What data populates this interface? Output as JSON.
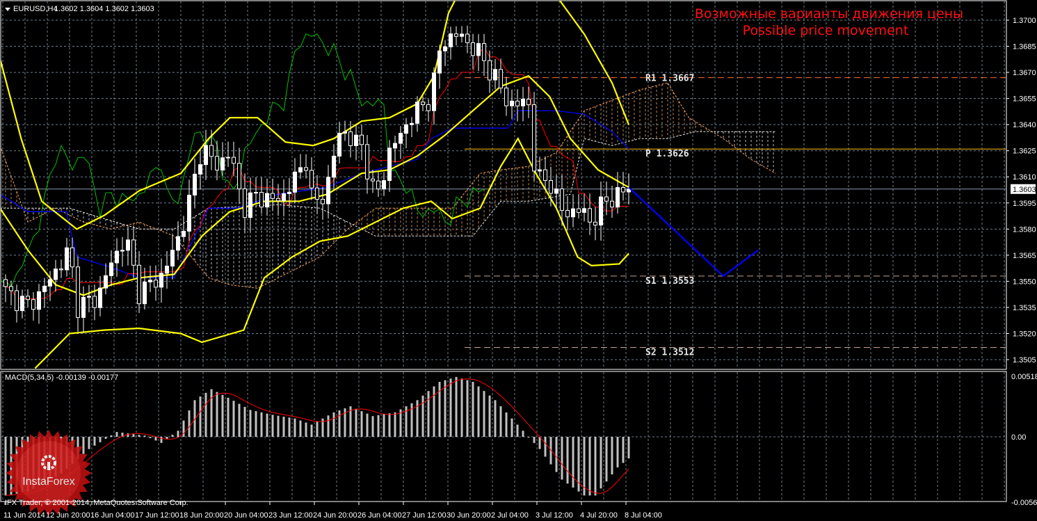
{
  "header": {
    "symbol": "EURUSD,H4",
    "ohlc": "1.3602 1.3604 1.3602 1.3603"
  },
  "annotation": {
    "line1": "Возможные варианты движения цены",
    "line2": "Possible price movement"
  },
  "macd_label": "MACD(5,34,5) -0.00139 -0.00177",
  "copyright": "IFX Trader, © 2001-2014, MetaQuotes Software Corp.",
  "watermark": "InstaForex",
  "colors": {
    "background": "#000000",
    "grid": "#6f8090",
    "band": "#ffff00",
    "tenkan": "#ff0000",
    "kijun": "#0000ff",
    "chikou": "#00c000",
    "spanA": "#f4a460",
    "spanB": "#e8e8e8",
    "projection": "#0000ff",
    "r1": "#ff6a2a",
    "pivot": "#ffc000",
    "support": "#c8a090",
    "macd_hist": "#c0c0c0",
    "macd_signal": "#ff0000"
  },
  "chart_data": {
    "type": "candlestick",
    "symbol": "EURUSD",
    "timeframe": "H4",
    "ylim": [
      1.3497,
      1.3712
    ],
    "y_ticks": [
      "1.3700",
      "1.3685",
      "1.3670",
      "1.3655",
      "1.3640",
      "1.3625",
      "1.3610",
      "1.3595",
      "1.3580",
      "1.3565",
      "1.3550",
      "1.3535",
      "1.3520",
      "1.3505"
    ],
    "current_price": "1.3603",
    "x_tick_labels": [
      "11 Jun 2014",
      "12 Jun 20:00",
      "16 Jun 04:00",
      "17 Jun 12:00",
      "18 Jun 20:00",
      "20 Jun 04:00",
      "23 Jun 12:00",
      "24 Jun 20:00",
      "26 Jun 04:00",
      "27 Jun 12:00",
      "30 Jun 20:00",
      "2 Jul 04:00",
      "3 Jul 12:00",
      "4 Jul 20:00",
      "8 Jul 04:00"
    ],
    "bar_count": 113,
    "close_keypoints": [
      [
        1,
        1.3544
      ],
      [
        5,
        1.3536
      ],
      [
        7.5,
        1.3544
      ],
      [
        12.5,
        1.3568
      ],
      [
        13.8,
        1.3536
      ],
      [
        17.5,
        1.354
      ],
      [
        18.8,
        1.3552
      ],
      [
        22.5,
        1.3576
      ],
      [
        25,
        1.3544
      ],
      [
        28.8,
        1.3552
      ],
      [
        31.3,
        1.3568
      ],
      [
        33.8,
        1.3592
      ],
      [
        36.3,
        1.3628
      ],
      [
        38.8,
        1.3616
      ],
      [
        41.3,
        1.3624
      ],
      [
        43.8,
        1.3592
      ],
      [
        46.3,
        1.36
      ],
      [
        48.8,
        1.3596
      ],
      [
        51.3,
        1.36
      ],
      [
        55,
        1.362
      ],
      [
        56.3,
        1.3592
      ],
      [
        58.8,
        1.3604
      ],
      [
        61.3,
        1.364
      ],
      [
        62.5,
        1.3632
      ],
      [
        65,
        1.3628
      ],
      [
        67.5,
        1.3596
      ],
      [
        70,
        1.3624
      ],
      [
        73.8,
        1.3644
      ],
      [
        77.5,
        1.3656
      ],
      [
        79.4,
        1.3688
      ],
      [
        82.5,
        1.3692
      ],
      [
        86.3,
        1.368
      ],
      [
        88.8,
        1.3668
      ],
      [
        91.3,
        1.3652
      ],
      [
        95,
        1.3652
      ],
      [
        96.3,
        1.3608
      ],
      [
        98.8,
        1.3608
      ],
      [
        101.3,
        1.3588
      ],
      [
        103.8,
        1.3592
      ],
      [
        106.3,
        1.3584
      ],
      [
        108.8,
        1.3596
      ],
      [
        113,
        1.3603
      ]
    ],
    "bollinger_upper": [
      [
        0,
        1.3678
      ],
      [
        3.8,
        1.3632
      ],
      [
        7.5,
        1.3596
      ],
      [
        13.8,
        1.358
      ],
      [
        18.8,
        1.3588
      ],
      [
        25,
        1.3602
      ],
      [
        32.5,
        1.3612
      ],
      [
        37.5,
        1.3632
      ],
      [
        41.3,
        1.3644
      ],
      [
        46.3,
        1.3644
      ],
      [
        51.3,
        1.363
      ],
      [
        56.3,
        1.3628
      ],
      [
        60,
        1.3632
      ],
      [
        65,
        1.3642
      ],
      [
        70,
        1.3644
      ],
      [
        75,
        1.3652
      ],
      [
        78,
        1.3668
      ],
      [
        80.6,
        1.3704
      ],
      [
        82.5,
        1.3716
      ],
      [
        96,
        1.3716
      ],
      [
        100,
        1.3714
      ],
      [
        105,
        1.3692
      ],
      [
        110,
        1.3664
      ],
      [
        113,
        1.364
      ]
    ],
    "bollinger_middle": [
      [
        0,
        1.3592
      ],
      [
        5,
        1.3568
      ],
      [
        10,
        1.3548
      ],
      [
        15,
        1.3542
      ],
      [
        20,
        1.3548
      ],
      [
        25,
        1.3552
      ],
      [
        31.3,
        1.3554
      ],
      [
        36.3,
        1.3576
      ],
      [
        41.3,
        1.359
      ],
      [
        47.5,
        1.3596
      ],
      [
        53.8,
        1.3596
      ],
      [
        58.8,
        1.36
      ],
      [
        65,
        1.3612
      ],
      [
        70,
        1.3614
      ],
      [
        75,
        1.3622
      ],
      [
        80,
        1.3634
      ],
      [
        85,
        1.3648
      ],
      [
        90,
        1.3662
      ],
      [
        95,
        1.3668
      ],
      [
        98.8,
        1.3656
      ],
      [
        102.5,
        1.3632
      ],
      [
        107.5,
        1.3614
      ],
      [
        113,
        1.3604
      ]
    ],
    "bollinger_lower": [
      [
        6.3,
        1.35
      ],
      [
        12.5,
        1.352
      ],
      [
        18.8,
        1.3522
      ],
      [
        25,
        1.3523
      ],
      [
        32.5,
        1.352
      ],
      [
        36.3,
        1.3515
      ],
      [
        43.8,
        1.3522
      ],
      [
        47.5,
        1.3552
      ],
      [
        52.5,
        1.3564
      ],
      [
        57.5,
        1.3573
      ],
      [
        62.5,
        1.3576
      ],
      [
        67.5,
        1.3584
      ],
      [
        72.5,
        1.3592
      ],
      [
        77.5,
        1.3596
      ],
      [
        81.3,
        1.3586
      ],
      [
        86.3,
        1.3592
      ],
      [
        90,
        1.3616
      ],
      [
        93.1,
        1.3632
      ],
      [
        96.3,
        1.3612
      ],
      [
        100,
        1.3592
      ],
      [
        103.8,
        1.3564
      ],
      [
        106.3,
        1.3559
      ],
      [
        111.3,
        1.356
      ],
      [
        113,
        1.3566
      ]
    ],
    "kijun": [
      [
        0,
        1.36
      ],
      [
        5,
        1.359
      ],
      [
        11.9,
        1.359
      ],
      [
        13.8,
        1.3564
      ],
      [
        20,
        1.3558
      ],
      [
        25,
        1.3552
      ],
      [
        31.3,
        1.3552
      ],
      [
        37.5,
        1.3592
      ],
      [
        42.5,
        1.3592
      ],
      [
        50,
        1.36
      ],
      [
        58.8,
        1.3604
      ],
      [
        65,
        1.3612
      ],
      [
        70,
        1.3616
      ],
      [
        75,
        1.362
      ],
      [
        77.5,
        1.3632
      ],
      [
        81.3,
        1.3638
      ],
      [
        91.3,
        1.3638
      ],
      [
        93.1,
        1.3648
      ],
      [
        100,
        1.3648
      ],
      [
        105,
        1.3646
      ],
      [
        110,
        1.3636
      ],
      [
        113,
        1.3626
      ]
    ],
    "cloud_span_a": [
      [
        0,
        1.3628
      ],
      [
        5,
        1.3584
      ],
      [
        10,
        1.3592
      ],
      [
        15,
        1.3584
      ],
      [
        20,
        1.358
      ],
      [
        25,
        1.3584
      ],
      [
        31.3,
        1.3576
      ],
      [
        37.5,
        1.3552
      ],
      [
        41.3,
        1.3548
      ],
      [
        46.3,
        1.3546
      ],
      [
        52.5,
        1.3556
      ],
      [
        57.5,
        1.3564
      ],
      [
        62.5,
        1.358
      ],
      [
        67.5,
        1.3592
      ],
      [
        75,
        1.3592
      ],
      [
        81.3,
        1.3592
      ],
      [
        86.3,
        1.3612
      ],
      [
        90,
        1.3614
      ],
      [
        95,
        1.3616
      ],
      [
        100,
        1.3624
      ],
      [
        105,
        1.3648
      ],
      [
        110,
        1.3654
      ],
      [
        115,
        1.366
      ],
      [
        120,
        1.3664
      ],
      [
        123.8,
        1.3644
      ],
      [
        130,
        1.3632
      ],
      [
        135,
        1.362
      ],
      [
        139.4,
        1.3612
      ]
    ],
    "cloud_span_b": [
      [
        0,
        1.3592
      ],
      [
        12.5,
        1.3592
      ],
      [
        25,
        1.358
      ],
      [
        31.3,
        1.358
      ],
      [
        37.5,
        1.3592
      ],
      [
        50,
        1.3594
      ],
      [
        57.5,
        1.3592
      ],
      [
        62.5,
        1.3584
      ],
      [
        67.5,
        1.3576
      ],
      [
        77.5,
        1.3576
      ],
      [
        85,
        1.3576
      ],
      [
        90,
        1.3596
      ],
      [
        95,
        1.3596
      ],
      [
        102.5,
        1.36
      ],
      [
        105,
        1.3632
      ],
      [
        110,
        1.3628
      ],
      [
        115,
        1.3632
      ],
      [
        120,
        1.3632
      ],
      [
        125,
        1.3636
      ],
      [
        139.4,
        1.3636
      ]
    ],
    "projection": [
      [
        113,
        1.3604
      ],
      [
        130,
        1.3553
      ],
      [
        136.3,
        1.3568
      ]
    ],
    "pivots": [
      {
        "label": "R1 1.3667",
        "value": 1.3667,
        "style": "dashed",
        "color_key": "r1"
      },
      {
        "label": "P 1.3626",
        "value": 1.3626,
        "style": "solid",
        "color_key": "pivot"
      },
      {
        "label": "S1 1.3553",
        "value": 1.3553,
        "style": "dashed",
        "color_key": "support"
      },
      {
        "label": "S2 1.3512",
        "value": 1.3512,
        "style": "dashed",
        "color_key": "support"
      }
    ],
    "macd": {
      "params": "5,34,5",
      "ylim": [
        -0.00562,
        0.00518
      ],
      "y_ticks": [
        "0.00518",
        "0.00",
        "-0.00562"
      ],
      "hist_keypoints": [
        [
          0,
          -0.0048
        ],
        [
          4,
          -0.0045
        ],
        [
          10,
          -0.003
        ],
        [
          15,
          -0.001
        ],
        [
          20,
          0.0004
        ],
        [
          25,
          0.0001
        ],
        [
          28,
          -0.0005
        ],
        [
          31,
          0.0005
        ],
        [
          34,
          0.003
        ],
        [
          37,
          0.0039
        ],
        [
          40,
          0.0032
        ],
        [
          44,
          0.0022
        ],
        [
          48,
          0.0018
        ],
        [
          52,
          0.0015
        ],
        [
          55,
          0.001
        ],
        [
          59,
          0.002
        ],
        [
          62,
          0.0025
        ],
        [
          66,
          0.0017
        ],
        [
          70,
          0.002
        ],
        [
          74,
          0.003
        ],
        [
          78,
          0.0045
        ],
        [
          81,
          0.0049
        ],
        [
          84,
          0.0045
        ],
        [
          88,
          0.003
        ],
        [
          92,
          0.001
        ],
        [
          96,
          -0.001
        ],
        [
          100,
          -0.0035
        ],
        [
          104,
          -0.0048
        ],
        [
          106,
          -0.0048
        ],
        [
          110,
          -0.0025
        ],
        [
          113,
          -0.0014
        ]
      ],
      "last_main": -0.00139,
      "last_signal": -0.00177
    }
  }
}
